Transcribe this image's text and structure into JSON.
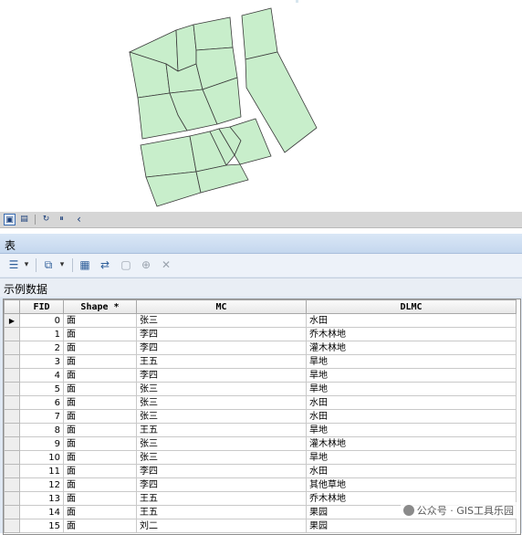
{
  "map": {
    "parcel_fill": "#c8eecb",
    "parcel_stroke": "#3a3a3a"
  },
  "map_toolbar": {
    "buttons": [
      {
        "icon": "data-view-icon",
        "glyph": "▣"
      },
      {
        "icon": "layout-view-icon",
        "glyph": "▤"
      },
      {
        "icon": "refresh-icon",
        "glyph": "↻"
      },
      {
        "icon": "pause-icon",
        "glyph": "⏸"
      },
      {
        "icon": "chevron-left-icon",
        "glyph": "‹"
      }
    ]
  },
  "table_window": {
    "title": "表",
    "toolbar": [
      {
        "icon": "table-options-icon",
        "glyph": "☰"
      },
      {
        "icon": "dropdown-arrow-icon",
        "glyph": "▾"
      },
      {
        "icon": "related-tables-icon",
        "glyph": "⧉"
      },
      {
        "icon": "dropdown-arrow-icon",
        "glyph": "▾"
      },
      {
        "icon": "select-by-attributes-icon",
        "glyph": "▦"
      },
      {
        "icon": "switch-selection-icon",
        "glyph": "⇄"
      },
      {
        "icon": "clear-selection-icon",
        "glyph": "▢"
      },
      {
        "icon": "zoom-to-selected-icon",
        "glyph": "⊕"
      },
      {
        "icon": "delete-selected-icon",
        "glyph": "✕"
      }
    ],
    "layer_tab": "示例数据",
    "columns": [
      "FID",
      "Shape *",
      "MC",
      "DLMC"
    ],
    "rows": [
      {
        "fid": "0",
        "shape": "面",
        "mc": "张三",
        "dlmc": "水田"
      },
      {
        "fid": "1",
        "shape": "面",
        "mc": "李四",
        "dlmc": "乔木林地"
      },
      {
        "fid": "2",
        "shape": "面",
        "mc": "李四",
        "dlmc": "灌木林地"
      },
      {
        "fid": "3",
        "shape": "面",
        "mc": "王五",
        "dlmc": "旱地"
      },
      {
        "fid": "4",
        "shape": "面",
        "mc": "李四",
        "dlmc": "旱地"
      },
      {
        "fid": "5",
        "shape": "面",
        "mc": "张三",
        "dlmc": "旱地"
      },
      {
        "fid": "6",
        "shape": "面",
        "mc": "张三",
        "dlmc": "水田"
      },
      {
        "fid": "7",
        "shape": "面",
        "mc": "张三",
        "dlmc": "水田"
      },
      {
        "fid": "8",
        "shape": "面",
        "mc": "王五",
        "dlmc": "旱地"
      },
      {
        "fid": "9",
        "shape": "面",
        "mc": "张三",
        "dlmc": "灌木林地"
      },
      {
        "fid": "10",
        "shape": "面",
        "mc": "张三",
        "dlmc": "旱地"
      },
      {
        "fid": "11",
        "shape": "面",
        "mc": "李四",
        "dlmc": "水田"
      },
      {
        "fid": "12",
        "shape": "面",
        "mc": "李四",
        "dlmc": "其他草地"
      },
      {
        "fid": "13",
        "shape": "面",
        "mc": "王五",
        "dlmc": "乔木林地"
      },
      {
        "fid": "14",
        "shape": "面",
        "mc": "王五",
        "dlmc": "果园"
      },
      {
        "fid": "15",
        "shape": "面",
        "mc": "刘二",
        "dlmc": "果园"
      }
    ],
    "current_row_marker": "▶"
  },
  "watermark": "公众号 · GIS工具乐园"
}
